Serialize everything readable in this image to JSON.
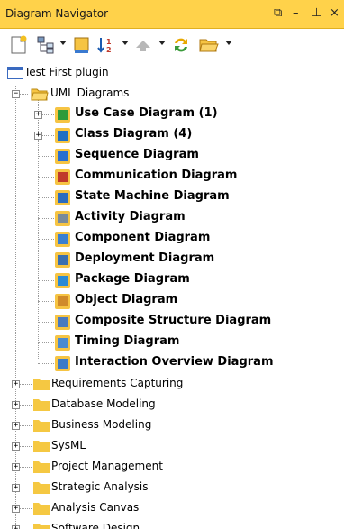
{
  "window": {
    "title": "Diagram Navigator",
    "restore_glyph": "⧉",
    "min_glyph": "–",
    "pin_glyph": "⊥",
    "close_glyph": "×"
  },
  "toolbar": {
    "buttons": [
      {
        "icon": "new-diagram-icon"
      },
      {
        "icon": "tree-view-icon"
      },
      {
        "icon": "bookmark-icon"
      },
      {
        "icon": "sort-icon"
      },
      {
        "icon": "up-arrow-icon"
      },
      {
        "icon": "refresh-icon"
      },
      {
        "icon": "open-folder-icon"
      }
    ]
  },
  "tree": {
    "root": "Test First plugin",
    "uml": {
      "label": "UML Diagrams",
      "children": [
        {
          "label": "Use Case Diagram (1)",
          "expandable": true,
          "color": "#2e9b3a"
        },
        {
          "label": "Class Diagram (4)",
          "expandable": true,
          "color": "#1f6fc4"
        },
        {
          "label": "Sequence Diagram",
          "expandable": false,
          "color": "#2a6fd0"
        },
        {
          "label": "Communication Diagram",
          "expandable": false,
          "color": "#c0392b"
        },
        {
          "label": "State Machine Diagram",
          "expandable": false,
          "color": "#2b6cc0"
        },
        {
          "label": "Activity Diagram",
          "expandable": false,
          "color": "#7a8a9a"
        },
        {
          "label": "Component Diagram",
          "expandable": false,
          "color": "#3a7fd0"
        },
        {
          "label": "Deployment Diagram",
          "expandable": false,
          "color": "#3a6fb0"
        },
        {
          "label": "Package Diagram",
          "expandable": false,
          "color": "#2a8ad6"
        },
        {
          "label": "Object Diagram",
          "expandable": false,
          "color": "#d08a2a"
        },
        {
          "label": "Composite Structure Diagram",
          "expandable": false,
          "color": "#4a7ac0"
        },
        {
          "label": "Timing Diagram",
          "expandable": false,
          "color": "#4a8ad0"
        },
        {
          "label": "Interaction Overview Diagram",
          "expandable": false,
          "color": "#3a7ac8"
        }
      ]
    },
    "folders": [
      "Requirements Capturing",
      "Database Modeling",
      "Business Modeling",
      "SysML",
      "Project Management",
      "Strategic Analysis",
      "Analysis Canvas",
      "Software Design"
    ],
    "expand_glyph": "+",
    "collapse_glyph": "−"
  },
  "colors": {
    "title_bar": "#ffd24a",
    "folder": "#f5c842",
    "diagram_tile": "#f6c443"
  }
}
